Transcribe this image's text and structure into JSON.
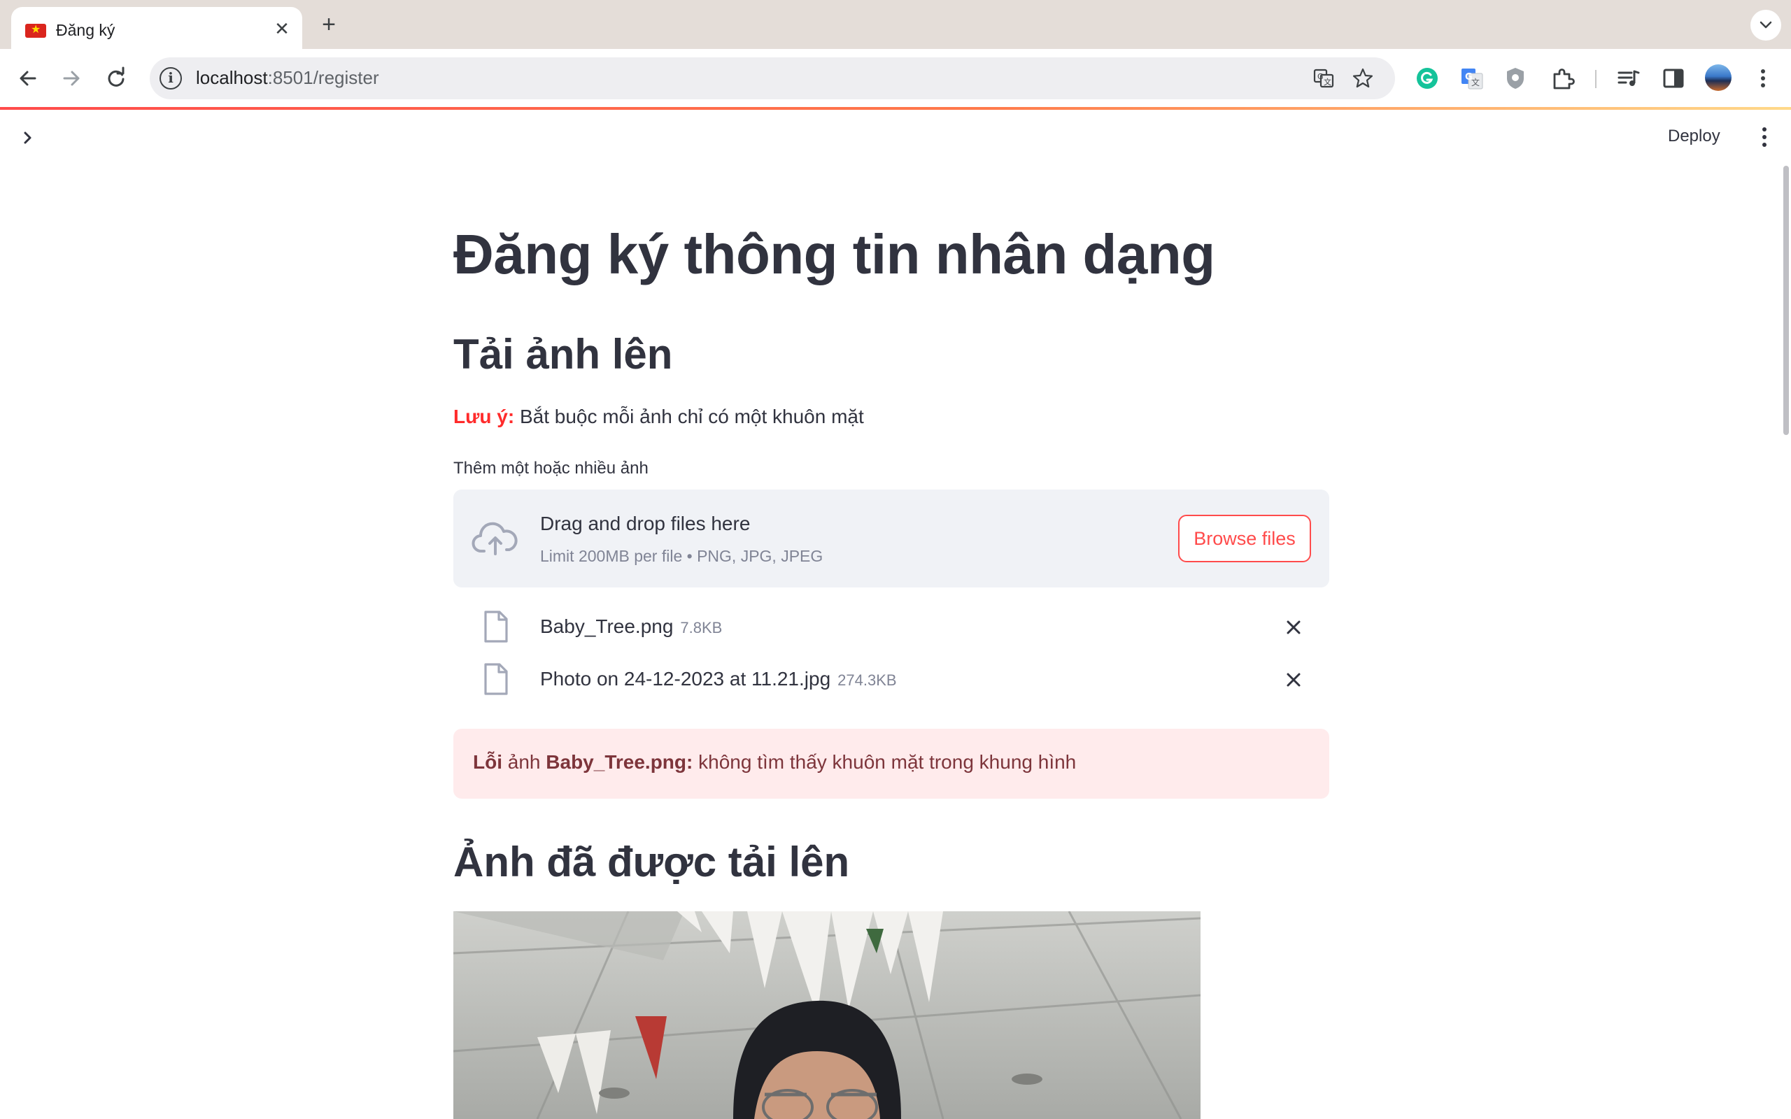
{
  "browser": {
    "tab_title": "Đăng ký",
    "url_host": "localhost",
    "url_rest": ":8501/register"
  },
  "header": {
    "deploy_label": "Deploy"
  },
  "page": {
    "title": "Đăng ký thông tin nhân dạng",
    "upload_section_title": "Tải ảnh lên",
    "note_label": "Lưu ý:",
    "note_text": " Bắt buộc mỗi ảnh chỉ có một khuôn mặt",
    "uploader_label": "Thêm một hoặc nhiều ảnh",
    "dropzone_title": "Drag and drop files here",
    "dropzone_limit": "Limit 200MB per file • PNG, JPG, JPEG",
    "browse_label": "Browse files",
    "files": [
      {
        "name": "Baby_Tree.png",
        "size": "7.8KB"
      },
      {
        "name": "Photo on 24-12-2023 at 11.21.jpg",
        "size": "274.3KB"
      }
    ],
    "error": {
      "prefix_bold": "Lỗi",
      "prefix_normal": " ảnh ",
      "file_bold": "Baby_Tree.png:",
      "message": " không tìm thấy khuôn mặt trong khung hình"
    },
    "uploaded_section_title": "Ảnh đã được tải lên"
  },
  "colors": {
    "accent": "#ff4b4b",
    "text": "#31333f",
    "error_bg": "#ffebec",
    "error_text": "#7d353b",
    "dropzone_bg": "#f0f2f6"
  },
  "icons": {
    "back": "arrow-left-icon",
    "forward": "arrow-right-icon",
    "reload": "reload-icon",
    "site_info": "info-icon",
    "translate": "translate-icon",
    "bookmark": "star-icon",
    "upload": "cloud-upload-icon",
    "file": "file-icon",
    "remove": "close-icon"
  }
}
